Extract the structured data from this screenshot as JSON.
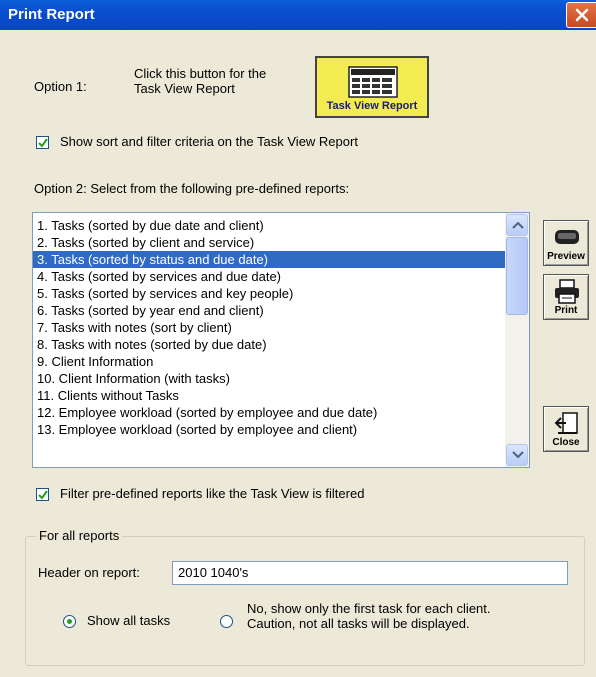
{
  "window": {
    "title": "Print Report"
  },
  "option1": {
    "label": "Option 1:",
    "description_line1": "Click this button for the",
    "description_line2": "Task View Report",
    "button_label": "Task View Report"
  },
  "show_criteria": {
    "checked": true,
    "label": "Show sort and filter criteria on the Task View Report"
  },
  "option2": {
    "label": "Option 2:  Select from the following pre-defined reports:"
  },
  "reports": {
    "selected_index": 2,
    "items": [
      "1.  Tasks (sorted by due date and client)",
      "2.  Tasks (sorted by client and service)",
      "3.  Tasks (sorted by status and due date)",
      "4.  Tasks (sorted by services and due date)",
      "5.  Tasks (sorted by services and key people)",
      "6.  Tasks (sorted by year end and client)",
      "7.  Tasks with notes (sort by client)",
      "8.  Tasks with notes (sorted by due date)",
      "9.  Client Information",
      "10.  Client Information (with tasks)",
      "11.  Clients without Tasks",
      "12.  Employee workload (sorted by employee and due date)",
      "13.  Employee workload (sorted by employee and client)"
    ]
  },
  "side_buttons": {
    "preview": "Preview",
    "print": "Print",
    "close": "Close"
  },
  "filter_predefined": {
    "checked": true,
    "label": "Filter pre-defined reports like the Task View is filtered"
  },
  "all_reports": {
    "group_title": "For all reports",
    "header_label": "Header on report:",
    "header_value": "2010 1040's",
    "radio_all_label": "Show all tasks",
    "radio_first_line1": "No, show only the first task for each client.",
    "radio_first_line2": "Caution, not all tasks will be displayed.",
    "selected": "all"
  }
}
